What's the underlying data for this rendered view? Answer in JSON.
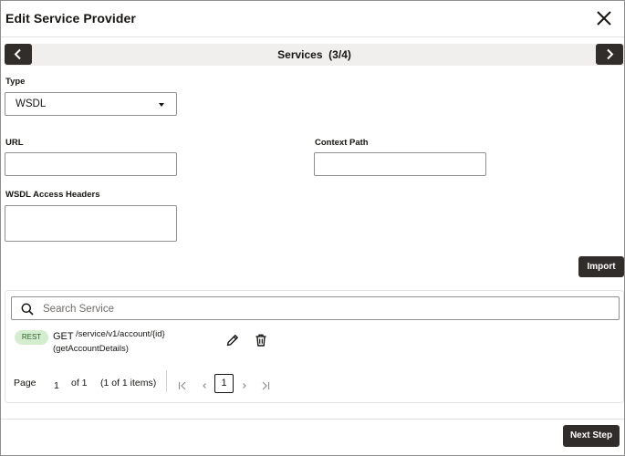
{
  "dialog": {
    "title": "Edit Service Provider",
    "close_icon": "close-icon"
  },
  "step_bar": {
    "title": "Services  (3/4)",
    "prev_icon": "chevron-left-icon",
    "next_icon": "chevron-right-icon"
  },
  "form": {
    "type_label": "Type",
    "type_value": "WSDL",
    "url_label": "URL",
    "url_value": "",
    "context_path_label": "Context Path",
    "context_path_value": "",
    "wsdl_headers_label": "WSDL Access Headers",
    "wsdl_headers_value": "",
    "import_label": "Import"
  },
  "services": {
    "search_placeholder": "Search Service",
    "items": [
      {
        "badge": "REST",
        "method": "GET",
        "path": "/service/v1/account/{id}",
        "operation": "(getAccountDetails)"
      }
    ],
    "pagination": {
      "page_label": "Page",
      "page_value": "1",
      "of_label": "of 1",
      "items_label": "(1 of 1 items)",
      "current_page": "1"
    }
  },
  "footer": {
    "next_step_label": "Next Step"
  },
  "colors": {
    "dark_button": "#312d2a",
    "step_bar_bg": "#f1efed",
    "rest_badge_bg": "#d4edcf",
    "rest_badge_text": "#2b5e26",
    "border": "#8f8f8f"
  }
}
